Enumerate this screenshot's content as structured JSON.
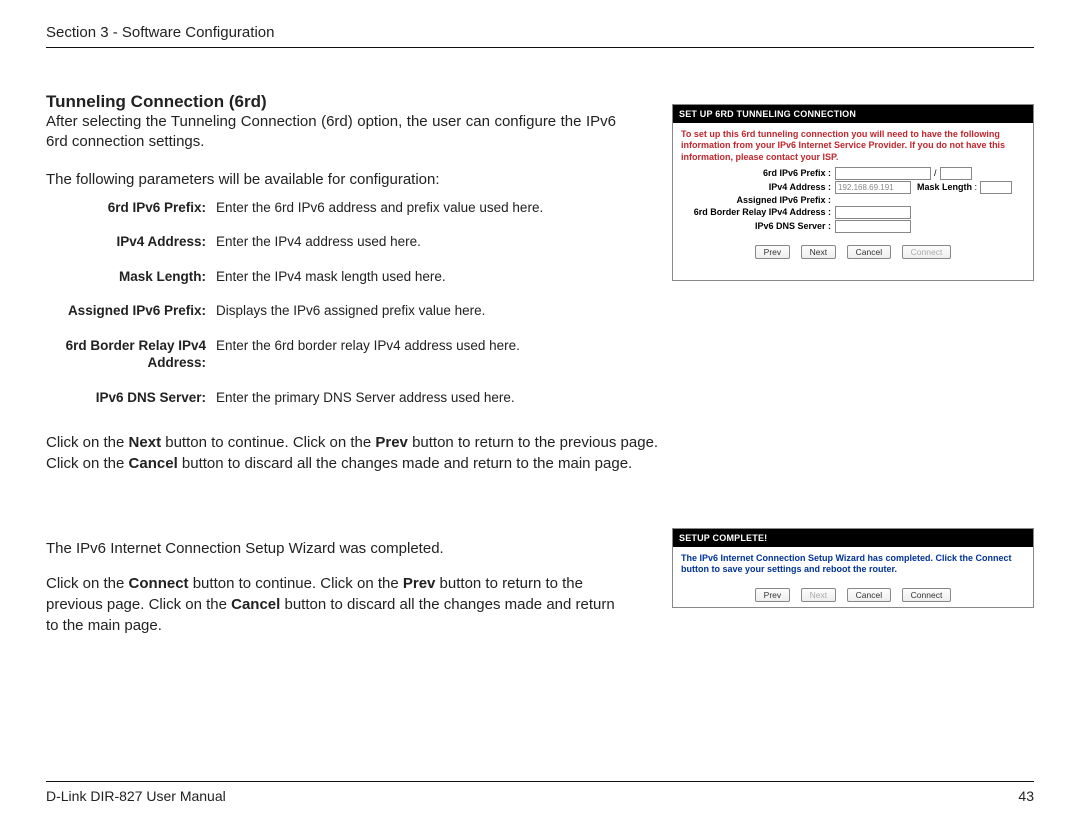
{
  "header": {
    "section": "Section 3 - Software Configuration"
  },
  "title": "Tunneling Connection (6rd)",
  "intro": "After selecting the Tunneling Connection (6rd) option, the user can configure the IPv6 6rd connection settings.",
  "lead": "The following parameters will be available for configuration:",
  "params": [
    {
      "label": "6rd IPv6 Prefix:",
      "desc": "Enter the 6rd IPv6 address and prefix value used here."
    },
    {
      "label": "IPv4 Address:",
      "desc": "Enter the IPv4 address used here."
    },
    {
      "label": "Mask Length:",
      "desc": "Enter the IPv4 mask length used here."
    },
    {
      "label": "Assigned IPv6 Prefix:",
      "desc": "Displays the IPv6 assigned prefix value here."
    },
    {
      "label": "6rd Border Relay IPv4 Address:",
      "desc": "Enter the 6rd border relay IPv4 address used here."
    },
    {
      "label": "IPv6 DNS Server:",
      "desc": "Enter the primary DNS Server address used here."
    }
  ],
  "p1a": "Click on the ",
  "p1b": "Next",
  "p1c": " button to continue. Click on the ",
  "p1d": "Prev",
  "p1e": " button to return to the previous page.",
  "p2a": "Click on the ",
  "p2b": "Cancel",
  "p2c": " button to discard all the changes made and return to the main page.",
  "s2_line": "The IPv6 Internet Connection Setup Wizard was completed.",
  "s2a": "Click on the ",
  "s2b": "Connect",
  "s2c": " button to continue. Click on the ",
  "s2d": "Prev",
  "s2e": " button to return to the previous page. Click on the ",
  "s2f": "Cancel",
  "s2g": " button to discard all the changes made and return to the main page.",
  "footer": {
    "left": "D-Link DIR-827 User Manual",
    "page": "43"
  },
  "shot1": {
    "title": "SET UP 6RD TUNNELING CONNECTION",
    "red": "To set up this 6rd tunneling connection you will need to have the following information from your IPv6 Internet Service Provider. If you do not have this information, please contact your ISP.",
    "labels": {
      "prefix": "6rd IPv6 Prefix",
      "ipv4": "IPv4 Address",
      "mask": "Mask Length",
      "assigned": "Assigned IPv6 Prefix",
      "relay": "6rd Border Relay IPv4 Address",
      "dns": "IPv6 DNS Server"
    },
    "ipv4_value": "192.168.69.191",
    "buttons": {
      "prev": "Prev",
      "next": "Next",
      "cancel": "Cancel",
      "connect": "Connect"
    }
  },
  "shot2": {
    "title": "SETUP COMPLETE!",
    "red": "The IPv6 Internet Connection Setup Wizard has completed. Click the Connect button to save your settings and reboot the router.",
    "buttons": {
      "prev": "Prev",
      "next": "Next",
      "cancel": "Cancel",
      "connect": "Connect"
    }
  }
}
